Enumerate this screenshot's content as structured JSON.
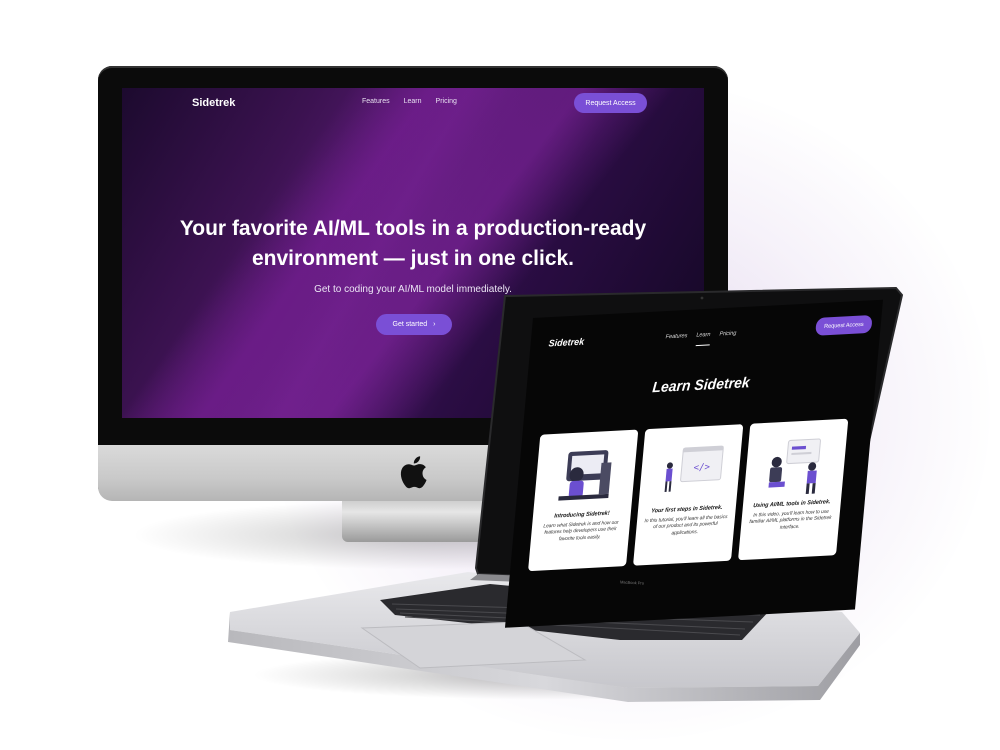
{
  "imac": {
    "brand": "Sidetrek",
    "nav_links": [
      "Features",
      "Learn",
      "Pricing"
    ],
    "cta": "Request Access",
    "headline": "Your favorite AI/ML tools in a production-ready environment — just in one click.",
    "subheadline": "Get to coding your AI/ML model immediately.",
    "get_started": "Get started",
    "get_started_icon": "chevron-right-icon"
  },
  "macbook": {
    "brand": "Sidetrek",
    "nav_links": [
      "Features",
      "Learn",
      "Pricing"
    ],
    "active_link": "Learn",
    "cta": "Request Access",
    "page_title": "Learn Sidetrek",
    "cards": [
      {
        "title": "Introducing Sidetrek!",
        "body": "Learn what Sidetrek is and how our features help developers use their favorite tools easily."
      },
      {
        "title": "Your first steps in Sidetrek.",
        "body": "In this tutorial, you'll learn all the basics of our product and its powerful applications."
      },
      {
        "title": "Using AI/ML tools in Sidetrek.",
        "body": "In this video, you'll learn how to use familiar AI/ML platforms in the Sidetrek interface."
      }
    ],
    "model_label": "MacBook Pro"
  },
  "colors": {
    "accent": "#7a4fd6",
    "hero_purple": "#5c1c78",
    "dark_bg": "#060606"
  }
}
